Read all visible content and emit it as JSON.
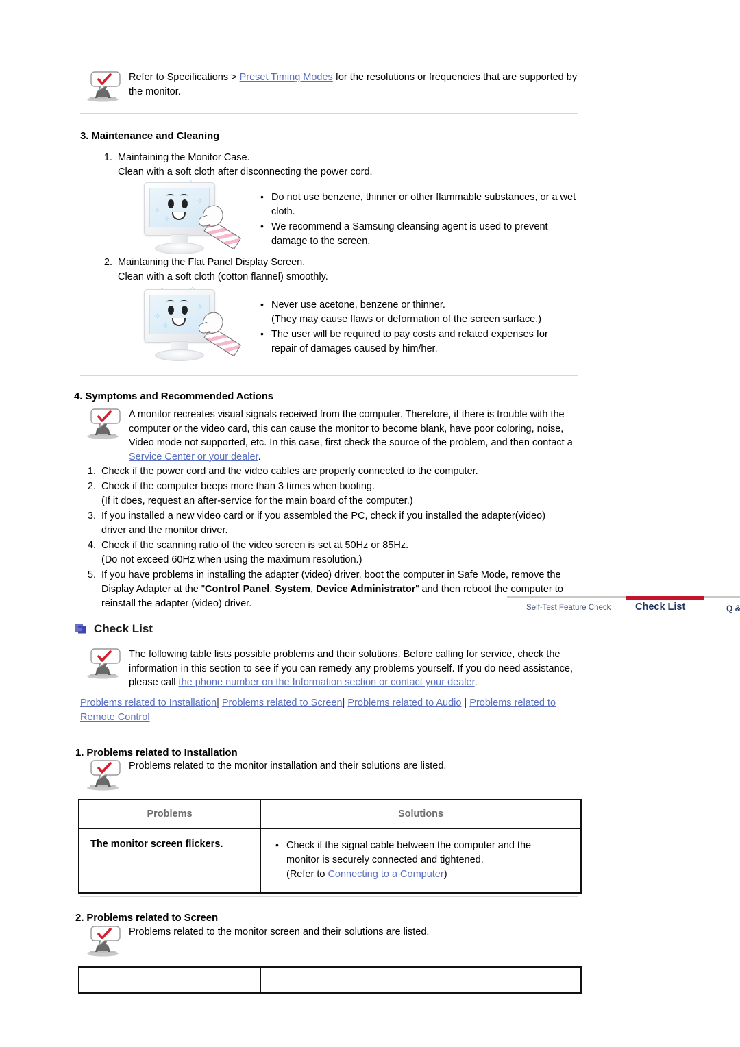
{
  "document": {
    "top_note": {
      "icon": "note-person-check-icon",
      "text_before": "Refer to Specifications > ",
      "link": "Preset Timing Modes",
      "text_after": " for the resolutions or frequencies that are supported by the monitor."
    },
    "section3": {
      "title": "3. Maintenance and Cleaning",
      "items": [
        {
          "num": "1.",
          "line1": "Maintaining the Monitor Case.",
          "line2": "Clean with a soft cloth after disconnecting the power cord.",
          "figure": "monitor-cleaning-illustration",
          "bullets": [
            "Do not use benzene, thinner or other flammable substances, or a wet cloth.",
            "We recommend a Samsung cleansing agent is used to prevent damage to the screen."
          ]
        },
        {
          "num": "2.",
          "line1": "Maintaining the Flat Panel Display Screen.",
          "line2": "Clean with a soft cloth (cotton flannel) smoothly.",
          "figure": "monitor-cleaning-illustration",
          "bullets": [
            "Never use acetone, benzene or thinner. (They may cause flaws or deformation of the screen surface.)",
            "The user will be required to pay costs and related expenses for repair of damages caused by him/her."
          ],
          "bullet1_line1": "Never use acetone, benzene or thinner.",
          "bullet1_line2": "(They may cause flaws or deformation of the screen surface.)",
          "bullet2_line1": "The user will be required to pay costs and related expenses for",
          "bullet2_line2": "repair of damages caused by him/her."
        }
      ]
    },
    "section4": {
      "title": "4. Symptoms and Recommended Actions",
      "note": {
        "text_before": "A monitor recreates visual signals received from the computer. Therefore, if there is trouble with the computer or the video card, this can cause the monitor to become blank, have poor coloring, noise, Video mode not supported, etc. In this case, first check the source of the problem, and then contact a ",
        "link": "Service Center or your dealer",
        "text_after": "."
      },
      "steps": [
        {
          "num": "1.",
          "line1": "Check if the power cord and the video cables are properly connected to the computer."
        },
        {
          "num": "2.",
          "line1": "Check if the computer beeps more than 3 times when booting.",
          "line2": "(If it does, request an after-service for the main board of the computer.)"
        },
        {
          "num": "3.",
          "line1": "If you installed a new video card or if you assembled the PC, check if you installed the adapter(video)",
          "line2": "driver and the monitor driver."
        },
        {
          "num": "4.",
          "line1": "Check if the scanning ratio of the video screen is set at 50Hz or 85Hz.",
          "line2": "(Do not exceed 60Hz when using the maximum resolution.)"
        },
        {
          "num": "5.",
          "pre": "If you have problems in installing the adapter (video) driver, boot the computer in Safe Mode, remove the Display Adapter at the \"",
          "bold1": "Control Panel",
          "mid1": ", ",
          "bold2": "System",
          "mid2": ", ",
          "bold3": "Device Administrator",
          "post": "\" and then reboot the computer to reinstall the adapter (video) driver."
        }
      ]
    },
    "tabs": {
      "items": [
        {
          "label": "Self-Test Feature Check",
          "active": false
        },
        {
          "label": "Check List",
          "active": true
        },
        {
          "label": "Q & A",
          "active": false
        }
      ],
      "accent_color": "#c0152c"
    },
    "checklist": {
      "icon": "blue-square-bullet-icon",
      "title": "Check List",
      "note": {
        "text_before": "The following table lists possible problems and their solutions. Before calling for service, check the information in this section to see if you can remedy any problems yourself. If you do need assistance, please call ",
        "link": "the phone number on the Information section or contact your dealer",
        "text_after": "."
      },
      "links": [
        "Problems related to Installation",
        "Problems related to Screen",
        "Problems related to Audio",
        "Problems related to Remote Control"
      ],
      "link_separator": "|"
    },
    "problem1": {
      "title": "1. Problems related to Installation",
      "note": "Problems related to the monitor installation and their solutions are listed.",
      "table": {
        "headers": [
          "Problems",
          "Solutions"
        ],
        "rows": [
          {
            "problem": "The monitor screen flickers.",
            "solution_line1": "Check if the signal cable between the computer and the",
            "solution_line2": "monitor is securely connected and tightened.",
            "solution_line3_pre": "(Refer to ",
            "solution_line3_link": "Connecting to a Computer",
            "solution_line3_post": ")"
          }
        ]
      }
    },
    "problem2": {
      "title": "2. Problems related to Screen",
      "note": "Problems related to the monitor screen and their solutions are listed."
    },
    "colors": {
      "link": "#5a6fc0",
      "accent_red": "#c0152c",
      "table_header_text": "#6d6d6d",
      "divider": "#d7d7d7"
    }
  }
}
